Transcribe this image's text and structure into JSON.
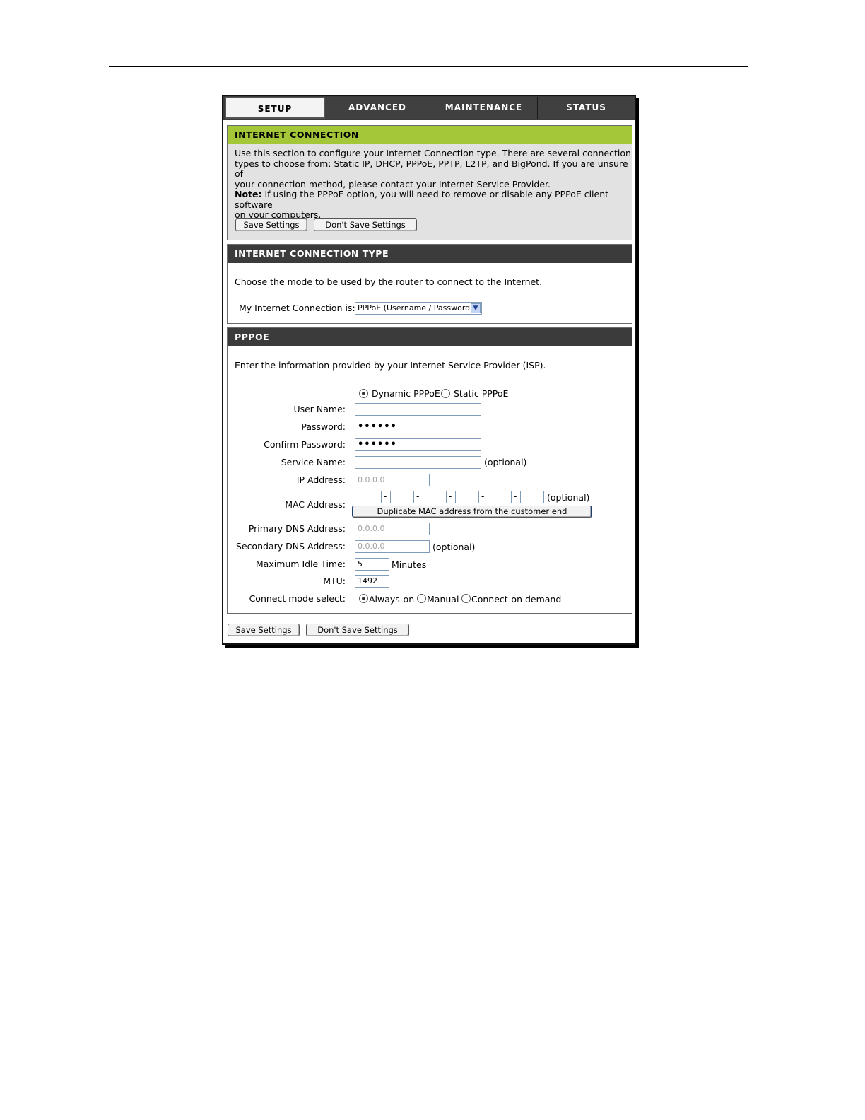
{
  "tabs": [
    "SETUP",
    "ADVANCED",
    "MAINTENANCE",
    "STATUS"
  ],
  "internet_connection": {
    "title": "INTERNET CONNECTION",
    "desc_lines": [
      "Use this section to configure your Internet Connection type. There are several connection",
      "types to choose from: Static IP, DHCP, PPPoE, PPTP, L2TP, and BigPond. If you are unsure of",
      "your connection method, please contact your Internet Service Provider."
    ],
    "note_label": "Note:",
    "note_line1": " If using the PPPoE option, you will need to remove or disable any PPPoE client software",
    "note_line2": "on your computers.",
    "save_label": "Save Settings",
    "dont_save_label": "Don't Save Settings"
  },
  "connection_type": {
    "title": "INTERNET CONNECTION TYPE",
    "desc": "Choose the mode to be used by the router to connect to the Internet.",
    "label": "My Internet Connection is:",
    "selected": "PPPoE (Username / Password)"
  },
  "pppoe": {
    "title": "PPPOE",
    "desc": "Enter the information provided by your Internet Service Provider (ISP).",
    "mode_options": [
      {
        "label": "Dynamic PPPoE",
        "selected": true
      },
      {
        "label": "Static PPPoE",
        "selected": false
      }
    ],
    "user_name_label": "User Name:",
    "user_name_value": "",
    "password_label": "Password:",
    "password_value": "••••••",
    "confirm_password_label": "Confirm Password:",
    "confirm_password_value": "••••••",
    "service_name_label": "Service Name:",
    "service_name_value": "",
    "optional": "(optional)",
    "ip_label": "IP Address:",
    "ip_value": "0.0.0.0",
    "mac_label": "MAC Address:",
    "mac_separator": "-",
    "duplicate_mac_label": "Duplicate MAC address from the customer end",
    "primary_dns_label": "Primary DNS Address:",
    "primary_dns_value": "0.0.0.0",
    "secondary_dns_label": "Secondary DNS Address:",
    "secondary_dns_value": "0.0.0.0",
    "idle_label": "Maximum Idle Time:",
    "idle_value": "5",
    "idle_unit": "Minutes",
    "mtu_label": "MTU:",
    "mtu_value": "1492",
    "connect_mode_label": "Connect mode select:",
    "connect_modes": [
      {
        "label": "Always-on",
        "selected": true
      },
      {
        "label": "Manual",
        "selected": false
      },
      {
        "label": "Connect-on demand",
        "selected": false
      }
    ]
  },
  "footer": {
    "save_label": "Save Settings",
    "dont_save_label": "Don't Save Settings"
  }
}
